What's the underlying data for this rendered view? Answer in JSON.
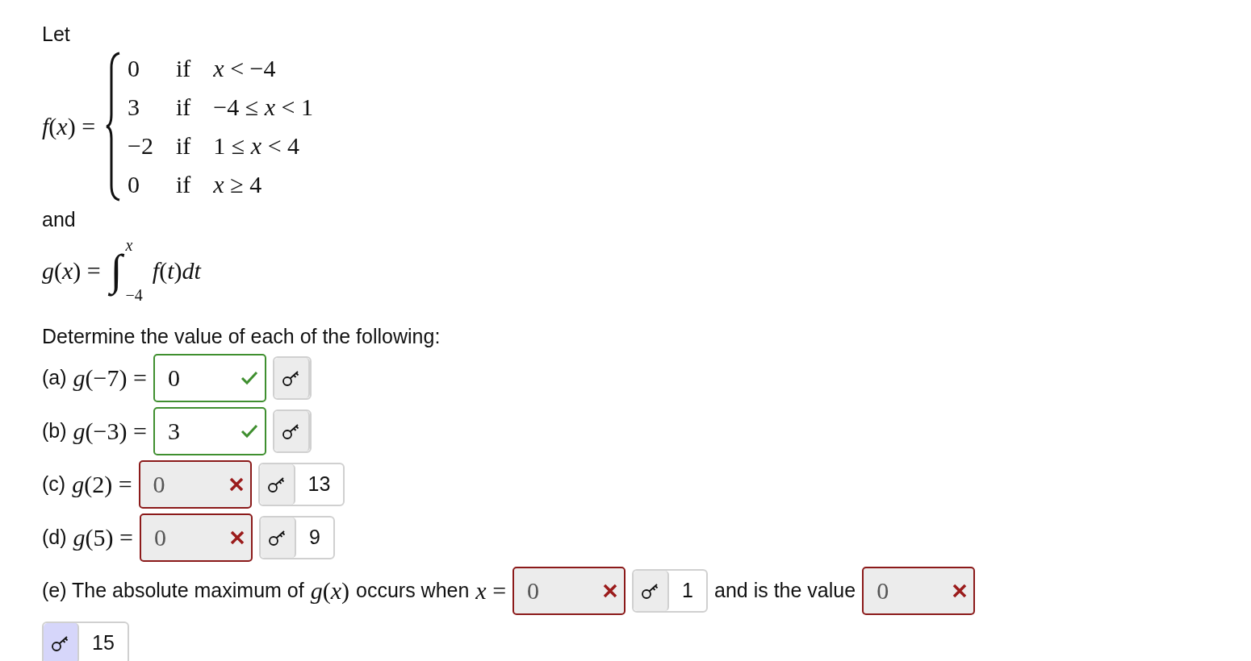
{
  "intro": "Let",
  "f_def": {
    "lhs": "*f*(*x*) =",
    "cases": [
      {
        "value": "0",
        "word": "if",
        "cond": "*x* < −4"
      },
      {
        "value": "3",
        "word": "if",
        "cond": "−4 ≤ *x* < 1"
      },
      {
        "value": "−2",
        "word": "if",
        "cond": "1 ≤ *x* < 4"
      },
      {
        "value": "0",
        "word": "if",
        "cond": "*x* ≥ 4"
      }
    ]
  },
  "connector": "and",
  "g_def": {
    "lhs": "*g*(*x*) =",
    "integral": "∫",
    "upper": "*x*",
    "lower": "−4",
    "integrand": "*f*(*t*)*dt*"
  },
  "prompt": "Determine the value of each of the following:",
  "parts": [
    {
      "items": [
        {
          "kind": "text",
          "text": "(a)"
        },
        {
          "kind": "math",
          "text": "*g*(−7) ="
        },
        {
          "kind": "field",
          "value": "0",
          "correct": true
        },
        {
          "kind": "key",
          "highlighted": false
        }
      ]
    },
    {
      "items": [
        {
          "kind": "text",
          "text": "(b)"
        },
        {
          "kind": "math",
          "text": "*g*(−3) ="
        },
        {
          "kind": "field",
          "value": "3",
          "correct": true
        },
        {
          "kind": "key",
          "highlighted": false
        }
      ]
    },
    {
      "items": [
        {
          "kind": "text",
          "text": "(c)"
        },
        {
          "kind": "math",
          "text": "*g*(2) ="
        },
        {
          "kind": "field",
          "value": "0",
          "correct": false
        },
        {
          "kind": "key",
          "count": "13",
          "highlighted": false
        }
      ]
    },
    {
      "items": [
        {
          "kind": "text",
          "text": "(d)"
        },
        {
          "kind": "math",
          "text": "*g*(5) ="
        },
        {
          "kind": "field",
          "value": "0",
          "correct": false
        },
        {
          "kind": "key",
          "count": "9",
          "highlighted": false
        }
      ]
    },
    {
      "items": [
        {
          "kind": "text",
          "text": "(e) The absolute maximum of"
        },
        {
          "kind": "math",
          "text": "*g*(*x*)"
        },
        {
          "kind": "text",
          "text": "occurs when"
        },
        {
          "kind": "math",
          "text": "*x* ="
        },
        {
          "kind": "field",
          "value": "0",
          "correct": false
        },
        {
          "kind": "key",
          "count": "1",
          "highlighted": false
        },
        {
          "kind": "text",
          "text": "and is the value"
        },
        {
          "kind": "field",
          "value": "0",
          "correct": false
        },
        {
          "kind": "key",
          "count": "15",
          "highlighted": true
        }
      ]
    }
  ]
}
